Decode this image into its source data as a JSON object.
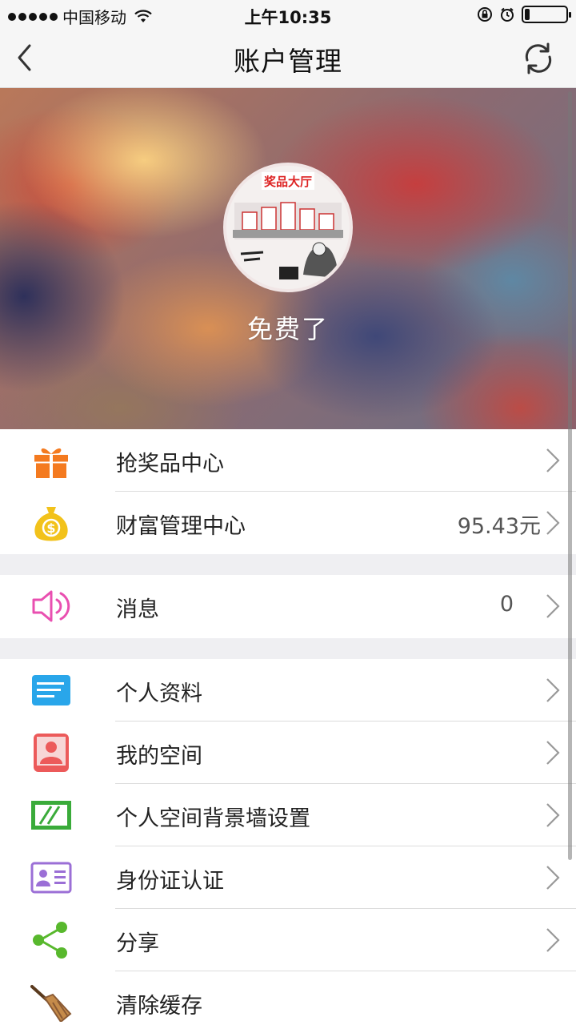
{
  "status_bar": {
    "carrier": "中国移动",
    "time": "上午10:35"
  },
  "nav": {
    "title": "账户管理",
    "back_icon": "chevron-left-icon",
    "refresh_icon": "refresh-icon"
  },
  "profile": {
    "username": "免费了",
    "avatar_text": "奖品大厅"
  },
  "section_1": [
    {
      "label": "抢奖品中心",
      "icon": "gift-icon",
      "value": ""
    },
    {
      "label": "财富管理中心",
      "icon": "money-bag-icon",
      "value": "95.43元"
    }
  ],
  "section_2": [
    {
      "label": "消息",
      "icon": "speaker-icon",
      "value": "0"
    }
  ],
  "section_3": [
    {
      "label": "个人资料",
      "icon": "profile-card-icon",
      "value": ""
    },
    {
      "label": "我的空间",
      "icon": "user-avatar-icon",
      "value": ""
    },
    {
      "label": "个人空间背景墙设置",
      "icon": "wallpaper-icon",
      "value": ""
    },
    {
      "label": "身份证认证",
      "icon": "id-card-icon",
      "value": ""
    },
    {
      "label": "分享",
      "icon": "share-icon",
      "value": ""
    },
    {
      "label": "清除缓存",
      "icon": "broom-icon",
      "value": ""
    }
  ],
  "colors": {
    "gift": "#f47a1f",
    "money": "#f2c21b",
    "speaker": "#e94fb0",
    "profile": "#29a6ea",
    "avatar": "#ec5a5a",
    "wallpaper": "#3aab3a",
    "idcard": "#9b6fd6",
    "share": "#58b82d",
    "broom": "#8a5a34"
  }
}
